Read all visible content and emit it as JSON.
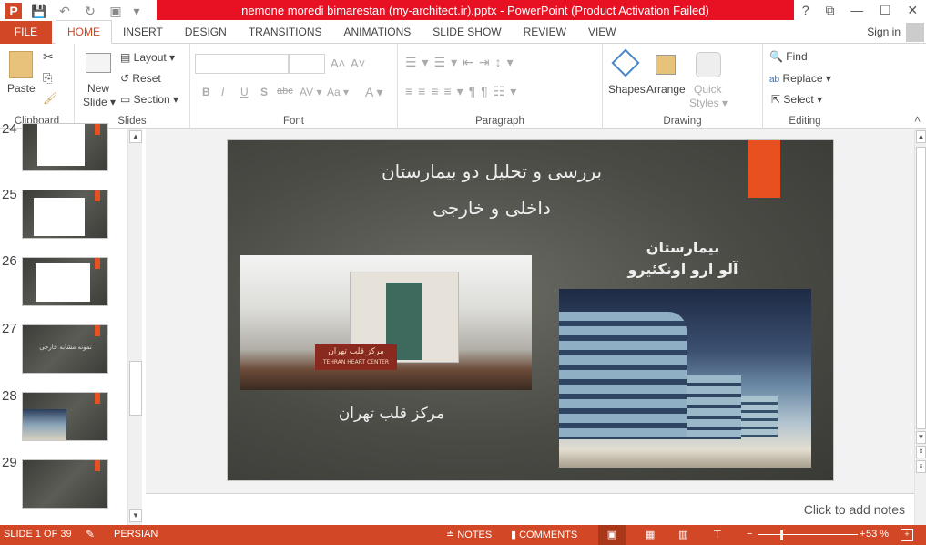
{
  "window": {
    "title": "nemone moredi bimarestan (my-architect.ir).pptx -  PowerPoint (Product Activation Failed)",
    "help": "?",
    "restore_ribbon": "⧉",
    "minimize": "—",
    "maximize": "☐",
    "close": "✕"
  },
  "qat": {
    "app_icon": "P",
    "save": "💾",
    "undo": "↶",
    "redo": "↻",
    "present": "▣",
    "customize": "▾"
  },
  "tabs": [
    {
      "label": "FILE"
    },
    {
      "label": "HOME"
    },
    {
      "label": "INSERT"
    },
    {
      "label": "DESIGN"
    },
    {
      "label": "TRANSITIONS"
    },
    {
      "label": "ANIMATIONS"
    },
    {
      "label": "SLIDE SHOW"
    },
    {
      "label": "REVIEW"
    },
    {
      "label": "VIEW"
    }
  ],
  "account": {
    "sign_in": "Sign in"
  },
  "ribbon": {
    "clipboard": {
      "label": "Clipboard",
      "paste": "Paste"
    },
    "slides": {
      "label": "Slides",
      "new_slide_1": "New",
      "new_slide_2": "Slide ▾",
      "layout": "Layout ▾",
      "reset": "Reset",
      "section": "Section ▾"
    },
    "font": {
      "label": "Font",
      "bold": "B",
      "italic": "I",
      "underline": "U",
      "shadow": "S",
      "strike": "abc",
      "spacing": "AV ▾",
      "case": "Aa ▾",
      "color": "A ▾",
      "grow": "A˄",
      "shrink": "A˅"
    },
    "paragraph": {
      "label": "Paragraph"
    },
    "drawing": {
      "label": "Drawing",
      "shapes": "Shapes",
      "arrange": "Arrange",
      "quick_styles_1": "Quick",
      "quick_styles_2": "Styles ▾"
    },
    "editing": {
      "label": "Editing",
      "find": "Find",
      "replace": "Replace ▾",
      "select": "Select ▾"
    }
  },
  "thumbnails": [
    {
      "number": "24"
    },
    {
      "number": "25"
    },
    {
      "number": "26"
    },
    {
      "number": "27",
      "text": "نمونه مشابه خارجی"
    },
    {
      "number": "28"
    },
    {
      "number": "29"
    }
  ],
  "slide": {
    "title_line1": "بررسی و تحلیل دو بیمارستان",
    "title_line2": "داخلی و خارجی",
    "right_heading_1": "بیمارستان",
    "right_heading_2": "آلو ارو اونکئیرو",
    "left_caption": "مرکز قلب تهران",
    "sign_text": "مرکز قلب تهران",
    "sign_text_en": "TEHRAN HEART CENTER",
    "accent": "#e8501f"
  },
  "notes": {
    "placeholder": "Click to add notes"
  },
  "status": {
    "slide": "SLIDE 1 OF 39",
    "language": "PERSIAN",
    "notes": "NOTES",
    "comments": "COMMENTS",
    "zoom": "53 %",
    "zoom_percent": 53,
    "color": "#d24726"
  }
}
